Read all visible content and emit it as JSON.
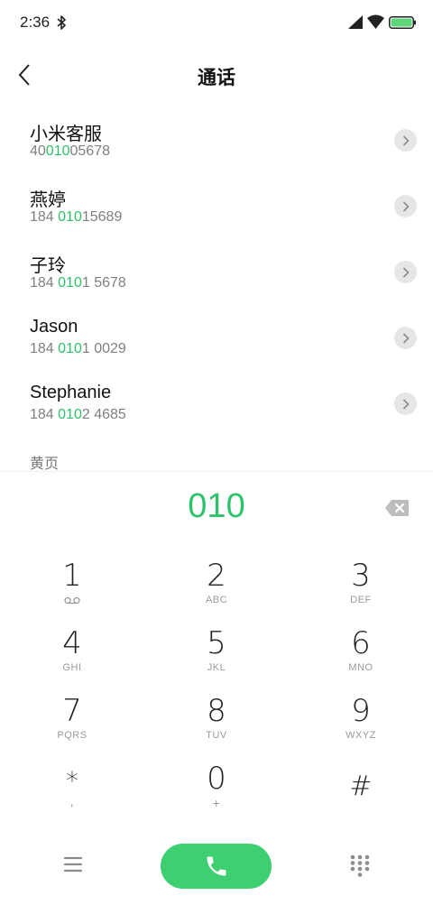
{
  "status_bar": {
    "time": "2:36"
  },
  "nav": {
    "title": "通话"
  },
  "contacts": [
    {
      "name": "小米客服",
      "number_pre": "40",
      "number_match": "010",
      "number_post": "05678"
    },
    {
      "name": "燕婷",
      "number_pre": "184 ",
      "number_match": "010",
      "number_post": "15689"
    },
    {
      "name": "子玲",
      "number_pre": "184 ",
      "number_match": "010",
      "number_post": "1 5678"
    },
    {
      "name": "Jason",
      "number_pre": "184 ",
      "number_match": "010",
      "number_post": "1 0029"
    },
    {
      "name": "Stephanie",
      "number_pre": "184 ",
      "number_match": "010",
      "number_post": "2 4685"
    }
  ],
  "section_label": "黄页",
  "dialer": {
    "input": "010"
  },
  "keypad": [
    {
      "digit": "1",
      "letters": ""
    },
    {
      "digit": "2",
      "letters": "ABC"
    },
    {
      "digit": "3",
      "letters": "DEF"
    },
    {
      "digit": "4",
      "letters": "GHI"
    },
    {
      "digit": "5",
      "letters": "JKL"
    },
    {
      "digit": "6",
      "letters": "MNO"
    },
    {
      "digit": "7",
      "letters": "PQRS"
    },
    {
      "digit": "8",
      "letters": "TUV"
    },
    {
      "digit": "9",
      "letters": "WXYZ"
    },
    {
      "digit": "*",
      "letters": ","
    },
    {
      "digit": "0",
      "letters": "+"
    },
    {
      "digit": "#",
      "letters": ""
    }
  ],
  "icons": {
    "bluetooth": "bluetooth-icon",
    "signal": "signal-icon",
    "wifi": "wifi-icon",
    "battery": "battery-icon",
    "back": "back-arrow-icon",
    "detail": "chevron-right-icon",
    "backspace": "backspace-icon",
    "voicemail": "voicemail-icon",
    "menu": "menu-icon",
    "call": "phone-icon",
    "keypad": "dialpad-icon"
  },
  "colors": {
    "accent": "#2fc26b",
    "call_button": "#3ecf71",
    "battery": "#5ed67a"
  }
}
